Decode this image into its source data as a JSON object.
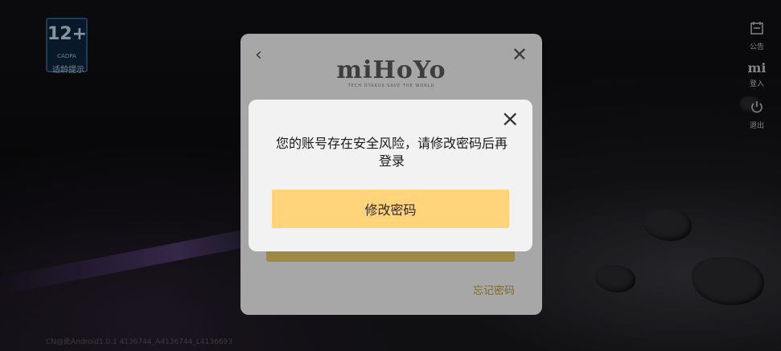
{
  "age_rating": {
    "value": "12+",
    "org": "CADPA",
    "tip": "适龄提示"
  },
  "right_menu": [
    {
      "icon": "notice-icon",
      "label": "公告"
    },
    {
      "icon": "mihoyo-mi-icon",
      "label": "登入"
    },
    {
      "icon": "power-icon",
      "label": "退出"
    }
  ],
  "footer_text": "CN@此Android1.0.1 4136744_A4136744_L4136693",
  "login_panel": {
    "brand": "miHoYo",
    "slogan": "TECH OTAKUS SAVE THE WORLD",
    "forgot_password": "忘记密码"
  },
  "dialog": {
    "message": "您的账号存在安全风险，请修改密码后再登录",
    "confirm_button": "修改密码",
    "accent_color": "#ffd47a"
  }
}
